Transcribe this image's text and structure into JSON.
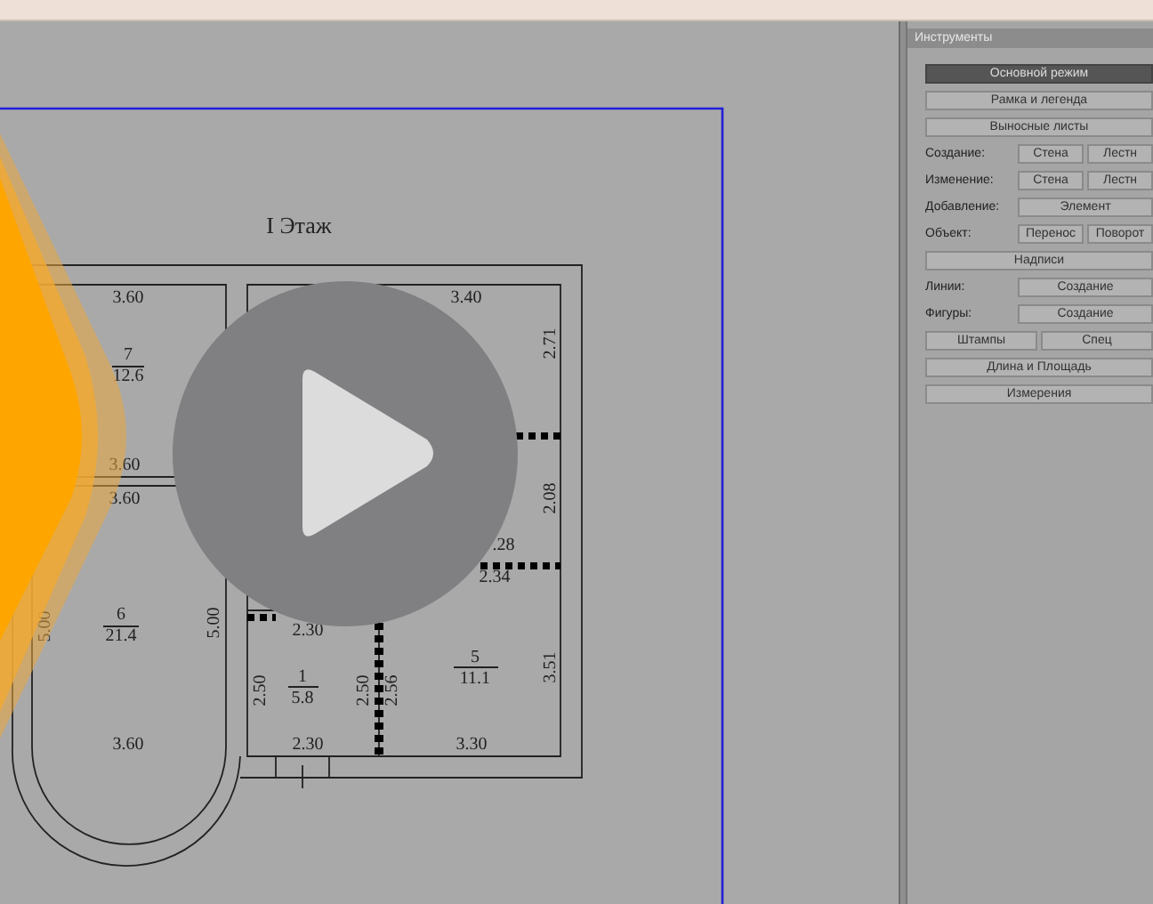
{
  "plan": {
    "title": "I Этаж",
    "labels": [
      {
        "text": "3.60",
        "kind": "h"
      },
      {
        "text": "7",
        "kind": "h"
      },
      {
        "text": "12.6",
        "kind": "h"
      },
      {
        "text": "3.40",
        "kind": "h"
      },
      {
        "text": "2.71",
        "kind": "v"
      },
      {
        "text": "3.60",
        "kind": "h"
      },
      {
        "text": "3.60",
        "kind": "h"
      },
      {
        "text": "2.08",
        "kind": "v"
      },
      {
        "text": ".28",
        "kind": "h"
      },
      {
        "text": "2.34",
        "kind": "h"
      },
      {
        "text": "6",
        "kind": "h"
      },
      {
        "text": "21.4",
        "kind": "h"
      },
      {
        "text": "5.00",
        "kind": "v"
      },
      {
        "text": "5.00",
        "kind": "v"
      },
      {
        "text": "2.30",
        "kind": "h"
      },
      {
        "text": "1",
        "kind": "h"
      },
      {
        "text": "5.8",
        "kind": "h"
      },
      {
        "text": "2.50",
        "kind": "v"
      },
      {
        "text": "2.50",
        "kind": "v"
      },
      {
        "text": "2.56",
        "kind": "v"
      },
      {
        "text": "5",
        "kind": "h"
      },
      {
        "text": "11.1",
        "kind": "h"
      },
      {
        "text": "3.51",
        "kind": "v"
      },
      {
        "text": "3.60",
        "kind": "h"
      },
      {
        "text": "2.30",
        "kind": "h"
      },
      {
        "text": "3.30",
        "kind": "h"
      }
    ]
  },
  "panel": {
    "title": "Инструменты",
    "rows": [
      {
        "kind": "button",
        "label": "Основной режим",
        "selected": true
      },
      {
        "kind": "button",
        "label": "Рамка и легенда",
        "selected": false
      },
      {
        "kind": "button",
        "label": "Выносные листы",
        "selected": false
      },
      {
        "kind": "labeled",
        "label": "Создание:",
        "buttons": [
          "Стена",
          "Лестн"
        ]
      },
      {
        "kind": "labeled",
        "label": "Изменение:",
        "buttons": [
          "Стена",
          "Лестн"
        ]
      },
      {
        "kind": "labeled",
        "label": "Добавление:",
        "buttons": [
          "Элемент"
        ]
      },
      {
        "kind": "labeled",
        "label": "Объект:",
        "buttons": [
          "Перенос",
          "Поворот"
        ]
      },
      {
        "kind": "button",
        "label": "Надписи",
        "selected": false
      },
      {
        "kind": "labeled",
        "label": "Линии:",
        "buttons": [
          "Создание"
        ]
      },
      {
        "kind": "labeled",
        "label": "Фигуры:",
        "buttons": [
          "Создание"
        ]
      },
      {
        "kind": "pair",
        "buttons": [
          "Штампы",
          "Спец"
        ]
      },
      {
        "kind": "button",
        "label": "Длина и Площадь",
        "selected": false
      },
      {
        "kind": "button",
        "label": "Измерения",
        "selected": false
      }
    ]
  }
}
